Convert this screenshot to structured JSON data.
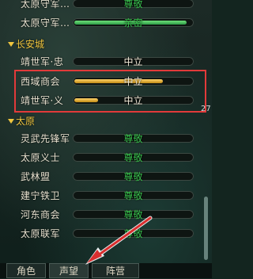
{
  "reputation": {
    "top_rows": [
      {
        "name": "太原守军…",
        "level": "尊敬",
        "fill": 0.0,
        "color": "green"
      },
      {
        "name": "太原守军…",
        "level": "亲密",
        "fill": 0.95,
        "color": "green"
      }
    ],
    "groups": [
      {
        "title": "长安城",
        "rows": [
          {
            "name": "靖世军·忠",
            "level": "中立",
            "fill": 0.0,
            "color": "gold"
          },
          {
            "name": "西域商会",
            "level": "中立",
            "fill": 0.75,
            "color": "gold"
          },
          {
            "name": "靖世军·义",
            "level": "中立",
            "fill": 0.2,
            "color": "gold"
          }
        ]
      },
      {
        "title": "太原",
        "rows": [
          {
            "name": "灵武先锋军",
            "level": "尊敬",
            "fill": 0.0,
            "color": "green"
          },
          {
            "name": "太原义士",
            "level": "尊敬",
            "fill": 0.0,
            "color": "green"
          },
          {
            "name": "武林盟",
            "level": "尊敬",
            "fill": 0.0,
            "color": "green"
          },
          {
            "name": "建宁铁卫",
            "level": "尊敬",
            "fill": 0.0,
            "color": "green"
          },
          {
            "name": "河东商会",
            "level": "尊敬",
            "fill": 0.0,
            "color": "green"
          },
          {
            "name": "太原联军",
            "level": "尊敬",
            "fill": 0.0,
            "color": "green"
          }
        ]
      }
    ]
  },
  "side_number": "27",
  "tabs": [
    "角色",
    "声望",
    "阵营"
  ],
  "colors": {
    "highlight": "#e23a3a",
    "respect": "#39c24e",
    "neutral": "#f1ead8",
    "group": "#f0c63f"
  }
}
